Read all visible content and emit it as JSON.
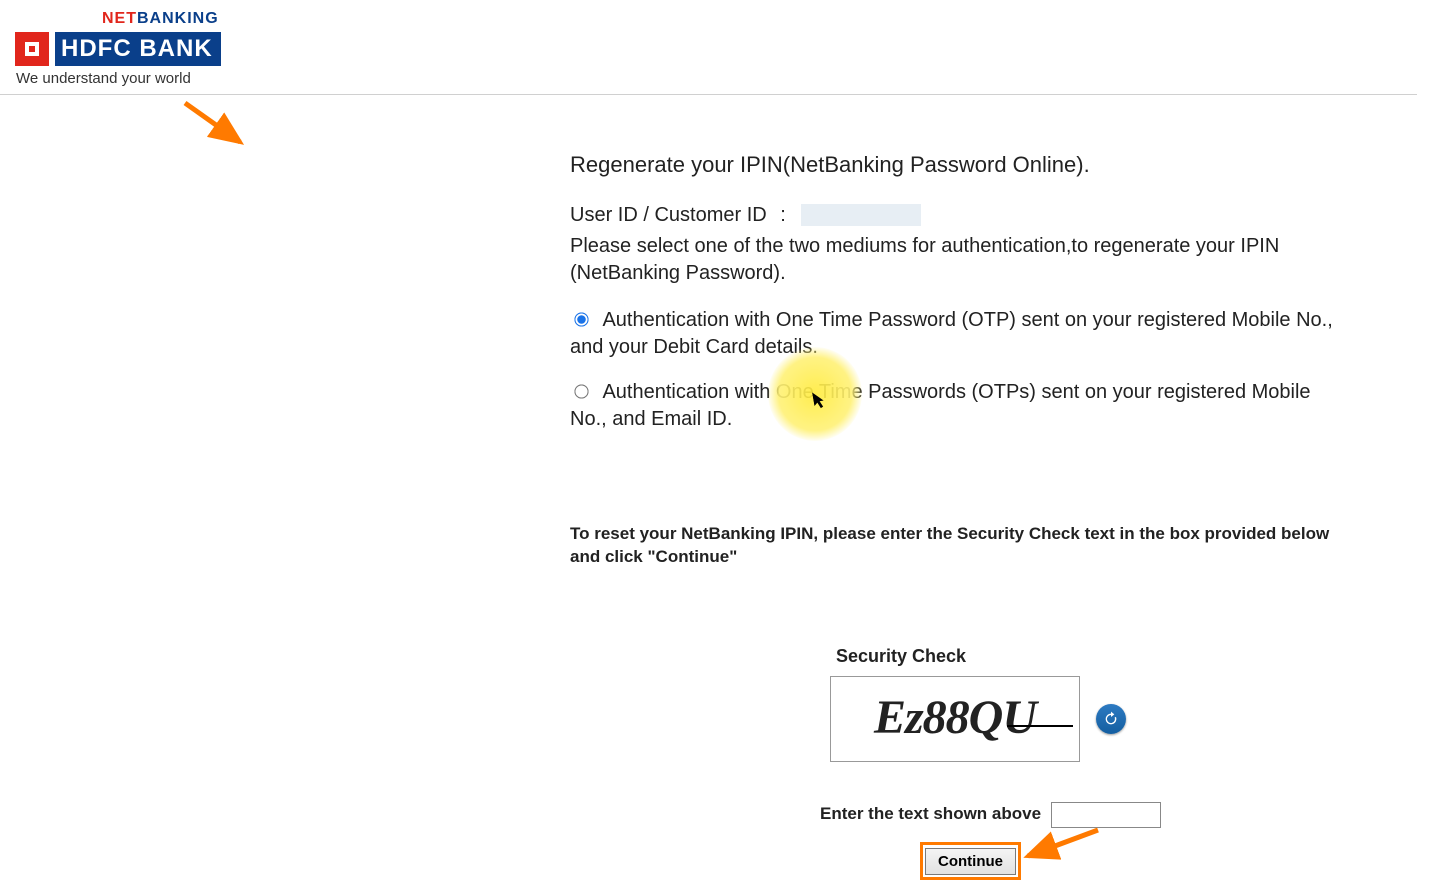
{
  "brand": {
    "netbanking_net": "NET",
    "netbanking_banking": "BANKING",
    "bank_name": "HDFC BANK",
    "tagline": "We understand your world"
  },
  "page": {
    "title": "Regenerate your IPIN(NetBanking Password Online).",
    "userid_label": "User ID / Customer ID",
    "userid_colon": ":",
    "userid_value": "",
    "instruction": "Please select one of the two mediums for authentication,to regenerate your IPIN (NetBanking Password)."
  },
  "options": {
    "opt1_label": "Authentication with One Time Password (OTP) sent on your registered Mobile No., and your Debit Card details.",
    "opt2_label": "Authentication with One Time Passwords (OTPs) sent on your registered Mobile No., and Email ID."
  },
  "security": {
    "note": "To reset your NetBanking IPIN, please enter the Security Check text in the box provided below and click \"Continue\"",
    "title": "Security Check",
    "captcha_text": "Ez88QU",
    "enter_label": "Enter the text shown above",
    "input_value": "",
    "continue_label": "Continue"
  }
}
